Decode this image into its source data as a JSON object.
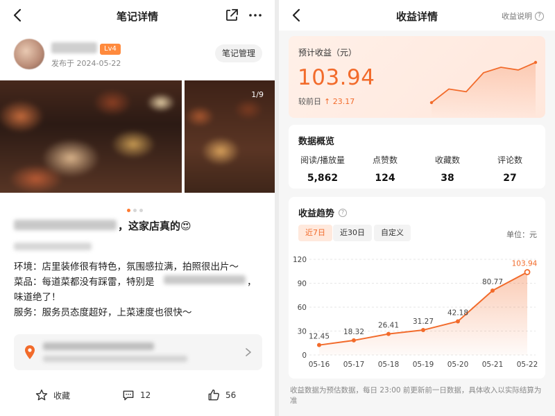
{
  "left": {
    "title": "笔记详情",
    "level_badge": "Lv4",
    "publish_date": "发布于 2024-05-22",
    "manage_button": "笔记管理",
    "photo_counter": "1/9",
    "headline_visible": "，这家店真的😍",
    "body_lines": [
      "环境：店里装修很有特色，氛围感拉满，拍照很出片～",
      "菜品：每道菜都没有踩雷，特别是",
      "味道绝了！",
      "服务：服务员态度超好，上菜速度也很快～"
    ],
    "actions": {
      "collect": "收藏",
      "comments": "12",
      "likes": "56"
    }
  },
  "right": {
    "title": "收益详情",
    "help_link": "收益说明",
    "earnings": {
      "label": "预计收益（元）",
      "value": "103.94",
      "compare_label": "较前日",
      "compare_delta": "↑ 23.17",
      "sparkline": [
        30,
        55,
        50,
        85,
        95,
        90,
        103.94
      ]
    },
    "overview": {
      "title": "数据概览",
      "stats": [
        {
          "label": "阅读/播放量",
          "value": "5,862"
        },
        {
          "label": "点赞数",
          "value": "124"
        },
        {
          "label": "收藏数",
          "value": "38"
        },
        {
          "label": "评论数",
          "value": "27"
        }
      ]
    },
    "trend": {
      "title": "收益趋势",
      "tabs": [
        "近7日",
        "近30日",
        "自定义"
      ],
      "active_tab": 0,
      "unit": "单位：元"
    },
    "footnote": "收益数据为预估数据，每日 23:00 前更新前一日数据，具体收入以实际结算为准"
  },
  "colors": {
    "accent": "#f26b2b",
    "badge": "#ff8a3d"
  },
  "chart_data": {
    "type": "area",
    "categories": [
      "05-16",
      "05-17",
      "05-18",
      "05-19",
      "05-20",
      "05-21",
      "05-22"
    ],
    "values": [
      12.45,
      18.32,
      26.41,
      31.27,
      42.18,
      80.77,
      103.94
    ],
    "ylim": [
      0,
      120
    ],
    "yticks": [
      0,
      30,
      60,
      90,
      120
    ],
    "grid": true
  }
}
